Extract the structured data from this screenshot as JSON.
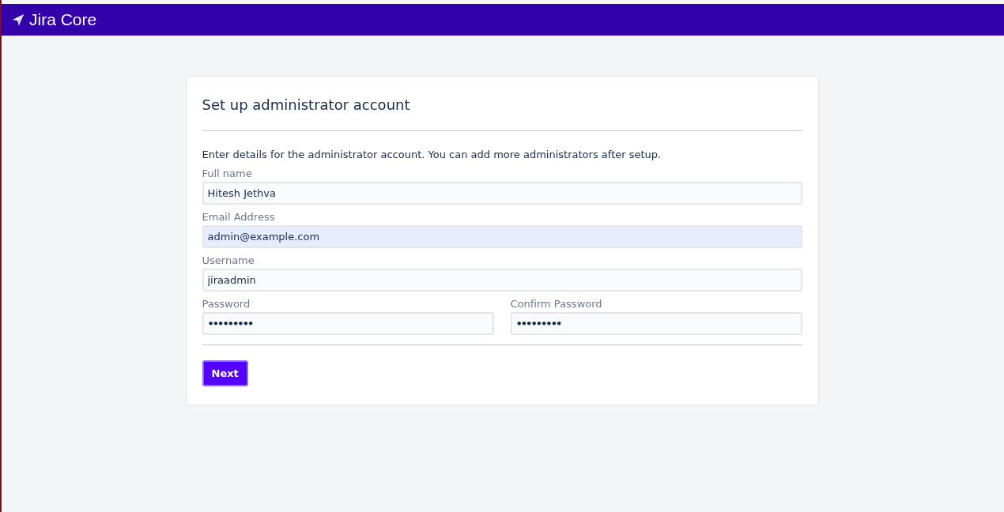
{
  "header": {
    "product": "Jira Core"
  },
  "form": {
    "title": "Set up administrator account",
    "intro": "Enter details for the administrator account. You can add more administrators after setup.",
    "rows": [
      [
        {
          "label": "Full name",
          "value": "Hitesh Jethva",
          "kind": "text",
          "autofilled": false
        }
      ],
      [
        {
          "label": "Email Address",
          "value": "admin@example.com",
          "kind": "text",
          "autofilled": true
        }
      ],
      [
        {
          "label": "Username",
          "value": "jiraadmin",
          "kind": "text",
          "autofilled": false
        }
      ],
      [
        {
          "label": "Password",
          "value": "•••••••••",
          "kind": "password",
          "autofilled": false
        },
        {
          "label": "Confirm Password",
          "value": "•••••••••",
          "kind": "password",
          "autofilled": false
        }
      ]
    ],
    "buttons": [
      "Next"
    ]
  }
}
